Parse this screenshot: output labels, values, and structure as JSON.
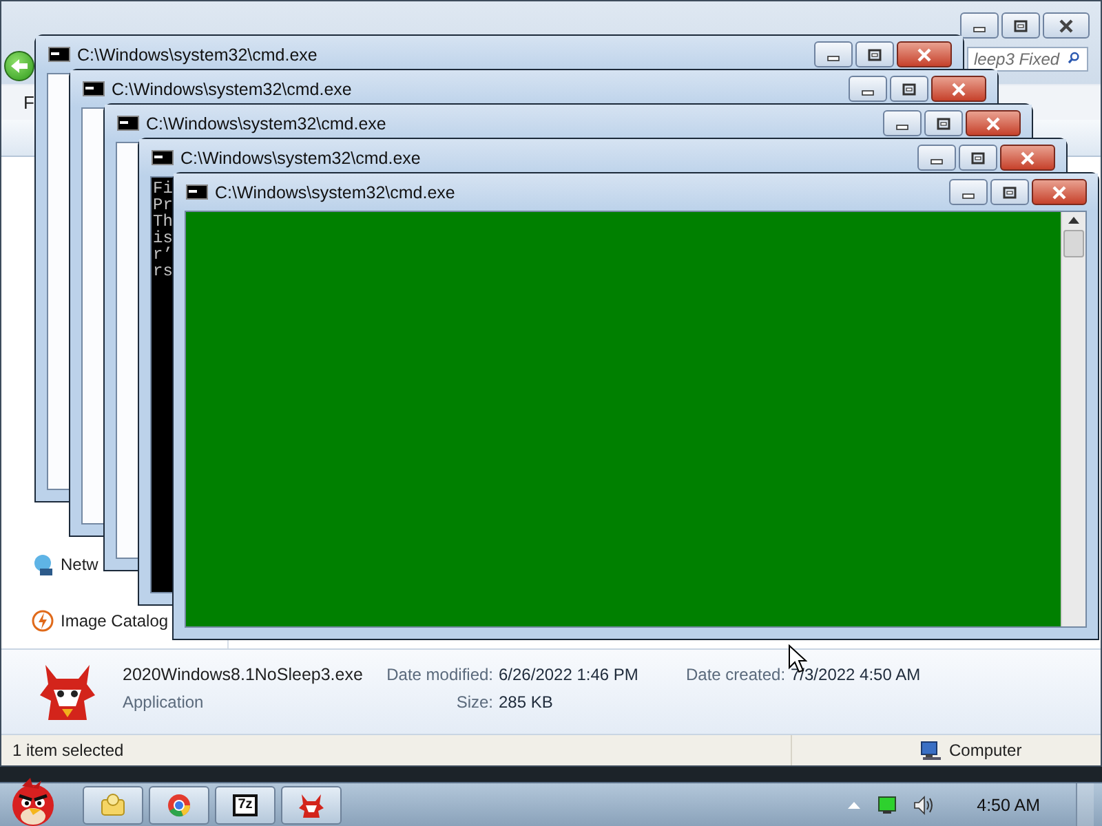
{
  "explorer": {
    "search": {
      "placeholder": "leep3 Fixed"
    },
    "menu": [
      "F"
    ],
    "sidebar": {
      "items": [
        {
          "label": "Netw",
          "kind": "network"
        },
        {
          "label": "Image Catalog",
          "kind": "catalog"
        }
      ]
    },
    "details": {
      "file_name": "2020Windows8.1NoSleep3.exe",
      "file_type": "Application",
      "fields": [
        {
          "label": "Date modified:",
          "value": "6/26/2022 1:46 PM"
        },
        {
          "label": "Size:",
          "value": "285 KB"
        },
        {
          "label": "Date created:",
          "value": "7/3/2022 4:50 AM"
        }
      ]
    },
    "status_bar": {
      "text": "1 item selected",
      "zone": "Computer"
    }
  },
  "cmd_windows": [
    {
      "title": "C:\\Windows\\system32\\cmd.exe",
      "kind": "frame"
    },
    {
      "title": "C:\\Windows\\system32\\cmd.exe",
      "kind": "frame"
    },
    {
      "title": "C:\\Windows\\system32\\cmd.exe",
      "kind": "frame"
    },
    {
      "title": "C:\\Windows\\system32\\cmd.exe",
      "kind": "console",
      "color": "#000000",
      "lines": [
        "Fi",
        "Pr",
        "Th",
        "is",
        "r’",
        "rs"
      ]
    },
    {
      "title": "C:\\Windows\\system32\\cmd.exe",
      "kind": "console",
      "color": "#008000"
    }
  ],
  "taskbar": {
    "apps": [
      {
        "kind": "explorer"
      },
      {
        "kind": "chrome"
      },
      {
        "kind": "archiver",
        "label": "7z"
      },
      {
        "kind": "devil"
      }
    ],
    "clock": "4:50 AM"
  }
}
